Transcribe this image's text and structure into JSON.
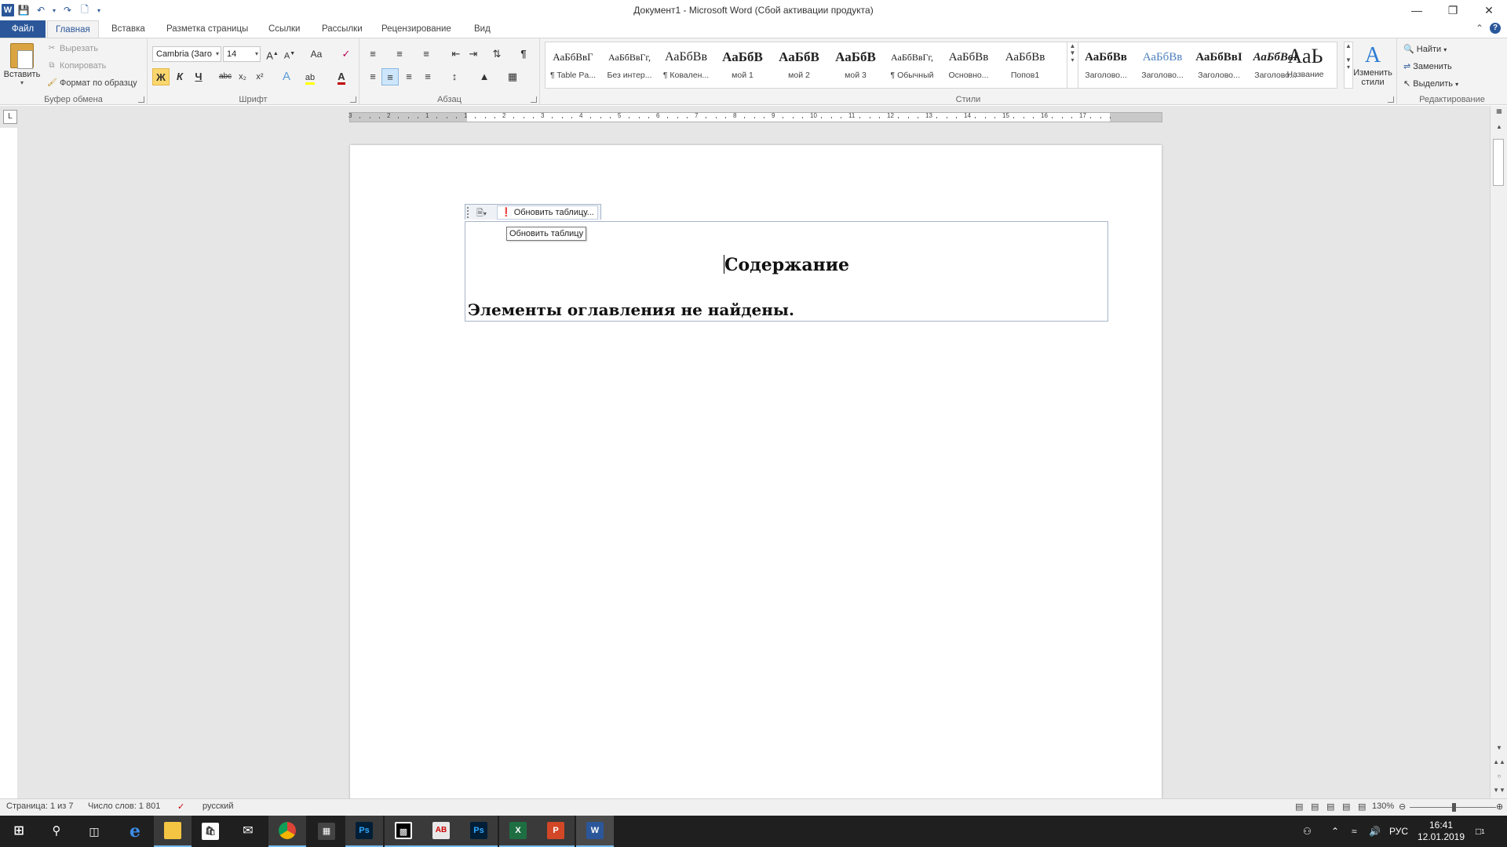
{
  "window": {
    "title": "Документ1  -  Microsoft Word (Сбой активации продукта)"
  },
  "qat": {
    "undo_icon": "undo-icon",
    "redo_icon": "redo-icon",
    "save_icon": "save-icon"
  },
  "tabs": [
    {
      "label": "Файл"
    },
    {
      "label": "Главная"
    },
    {
      "label": "Вставка"
    },
    {
      "label": "Разметка страницы"
    },
    {
      "label": "Ссылки"
    },
    {
      "label": "Рассылки"
    },
    {
      "label": "Рецензирование"
    },
    {
      "label": "Вид"
    }
  ],
  "clipboard": {
    "paste": "Вставить",
    "cut": "Вырезать",
    "copy": "Копировать",
    "format_painter": "Формат по образцу",
    "group_label": "Буфер обмена"
  },
  "font": {
    "name": "Cambria (Заго",
    "size": "14",
    "group_label": "Шрифт",
    "bold": "Ж",
    "italic": "К",
    "underline": "Ч",
    "strike": "abc",
    "sub": "x₂",
    "sup": "x²",
    "grow": "A",
    "shrink": "A",
    "case": "Aa",
    "color_letter": "A"
  },
  "paragraph": {
    "group_label": "Абзац",
    "pilcrow": "¶"
  },
  "styles": {
    "group_label": "Стили",
    "items": [
      {
        "preview": "АаБбВвГ",
        "label": "¶ Table Pa..."
      },
      {
        "preview": "АаБбВвГг,",
        "label": "Без интер..."
      },
      {
        "preview": "АаБбВв",
        "label": "¶ Ковален..."
      },
      {
        "preview": "АаБбВ",
        "label": "мой 1"
      },
      {
        "preview": "АаБбВ",
        "label": "мой 2"
      },
      {
        "preview": "АаБбВ",
        "label": "мой 3"
      },
      {
        "preview": "АаБбВвГг,",
        "label": "¶ Обычный"
      },
      {
        "preview": "АаБбВв",
        "label": "Основно..."
      },
      {
        "preview": "АаБбВв",
        "label": "Попов1"
      },
      {
        "preview": "АаБбВв",
        "label": "Заголово..."
      },
      {
        "preview": "АаБбВв",
        "label": "Заголово..."
      },
      {
        "preview": "АаБбВвI",
        "label": "Заголово..."
      },
      {
        "preview": "АаБбВвI",
        "label": "Заголово..."
      },
      {
        "preview": "АаЬ",
        "label": "Название"
      }
    ],
    "change_styles": "Изменить стили"
  },
  "editing": {
    "group_label": "Редактирование",
    "find": "Найти",
    "replace": "Заменить",
    "select": "Выделить"
  },
  "ruler": {
    "numbers": [
      "3",
      "2",
      "1",
      "1",
      "2",
      "3",
      "4",
      "5",
      "6",
      "7",
      "8",
      "9",
      "10",
      "11",
      "12",
      "13",
      "14",
      "15",
      "16",
      "17"
    ]
  },
  "document": {
    "toc_toolbar_label": "Обновить таблицу...",
    "tooltip": "Обновить таблицу",
    "toc_heading": "Содержание",
    "toc_empty": "Элементы оглавления не найдены."
  },
  "status": {
    "page": "Страница: 1 из 7",
    "words": "Число слов: 1 801",
    "language": "русский",
    "zoom": "130%"
  },
  "taskbar": {
    "apps": [
      "windows-start",
      "search",
      "task-view",
      "edge",
      "explorer",
      "store",
      "mail",
      "chrome",
      "calculator",
      "photoshop",
      "media",
      "abbyy",
      "photoshop-2",
      "excel",
      "powerpoint",
      "word"
    ],
    "lang": "РУС",
    "time": "16:41",
    "date": "12.01.2019",
    "notif_count": "1"
  },
  "colors": {
    "accent": "#2b579a",
    "ribbon_bg": "#f3f3f3",
    "taskbar_bg": "#1f1f1f"
  }
}
